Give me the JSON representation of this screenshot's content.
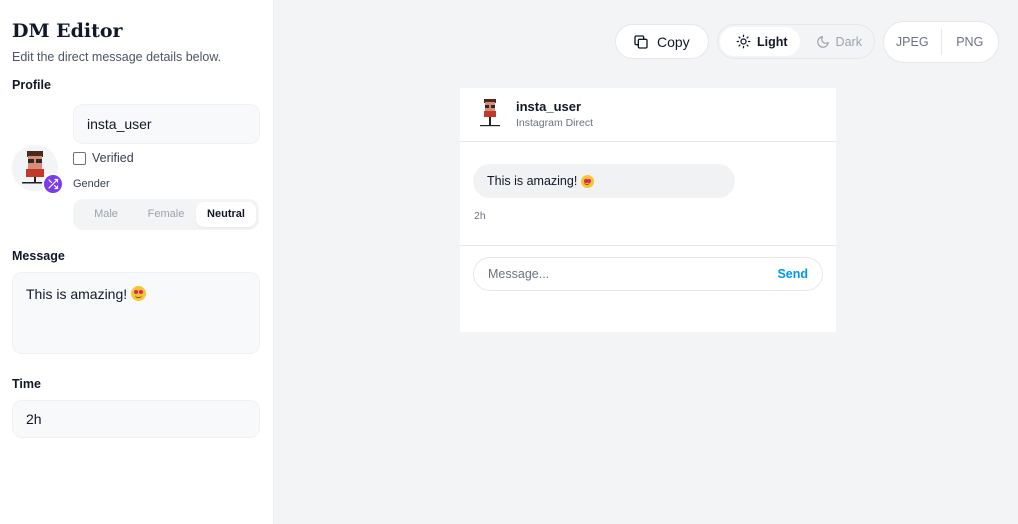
{
  "sidebar": {
    "title": "DM Editor",
    "subtitle": "Edit the direct message details below.",
    "profile_label": "Profile",
    "username": "insta_user",
    "verified_label": "Verified",
    "verified": false,
    "gender_label": "Gender",
    "gender_options": [
      "Male",
      "Female",
      "Neutral"
    ],
    "gender_selected": "Neutral",
    "message_label": "Message",
    "message_value": "This is amazing!",
    "time_label": "Time",
    "time_value": "2h"
  },
  "toolbar": {
    "copy_label": "Copy",
    "theme_light_label": "Light",
    "theme_dark_label": "Dark",
    "theme_selected": "Light",
    "export_jpeg_label": "JPEG",
    "export_png_label": "PNG"
  },
  "preview": {
    "username": "insta_user",
    "subtitle": "Instagram Direct",
    "message_text": "This is amazing!",
    "message_emoji": "heart-eyes-emoji",
    "time": "2h",
    "composer_placeholder": "Message...",
    "send_label": "Send"
  },
  "colors": {
    "accent_purple": "#7c3aed",
    "send_blue": "#0095f6",
    "background": "#f3f4f6"
  }
}
